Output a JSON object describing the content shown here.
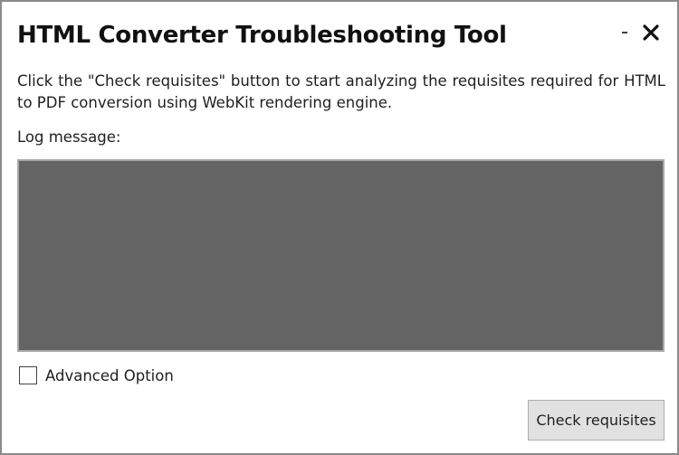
{
  "window": {
    "title": "HTML Converter Troubleshooting Tool",
    "minimize_label": "-",
    "close_icon": "close-icon"
  },
  "main": {
    "description": "Click the \"Check requisites\" button to start analyzing the requisites required for HTML to PDF conversion using WebKit rendering engine.",
    "log_label": "Log message:",
    "log_text": ""
  },
  "options": {
    "advanced_label": "Advanced Option",
    "advanced_checked": false
  },
  "actions": {
    "check_label": "Check requisites"
  },
  "colors": {
    "log_background": "#646464",
    "button_background": "#e1e1e1",
    "window_border": "#8a8a8a"
  }
}
